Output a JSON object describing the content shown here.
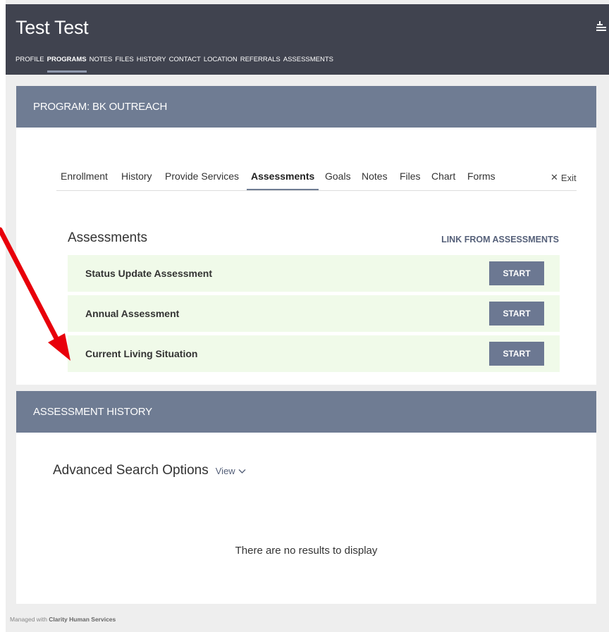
{
  "header": {
    "client_name": "Test Test",
    "nav": [
      "PROFILE",
      "PROGRAMS",
      "NOTES",
      "FILES",
      "HISTORY",
      "CONTACT",
      "LOCATION",
      "REFERRALS",
      "ASSESSMENTS"
    ],
    "active_nav": "PROGRAMS"
  },
  "program": {
    "title": "PROGRAM: BK OUTREACH",
    "tabs": [
      "Enrollment",
      "History",
      "Provide Services",
      "Assessments",
      "Goals",
      "Notes",
      "Files",
      "Chart",
      "Forms"
    ],
    "active_tab": "Assessments",
    "exit_label": "Exit"
  },
  "assessments": {
    "title": "Assessments",
    "link_label": "LINK FROM ASSESSMENTS",
    "rows": [
      {
        "name": "Status Update Assessment",
        "button": "START"
      },
      {
        "name": "Annual Assessment",
        "button": "START"
      },
      {
        "name": "Current Living Situation",
        "button": "START"
      }
    ]
  },
  "history": {
    "title": "ASSESSMENT HISTORY",
    "search_title": "Advanced Search Options",
    "view_label": "View",
    "empty_message": "There are no results to display"
  },
  "footer": {
    "prefix": "Managed with",
    "brand": "Clarity Human Services"
  },
  "colors": {
    "header_bg": "#40434f",
    "section_header": "#6f7c93",
    "row_bg": "#f0fae9",
    "button_bg": "#6c7892",
    "annotation_arrow": "#e8000b"
  }
}
